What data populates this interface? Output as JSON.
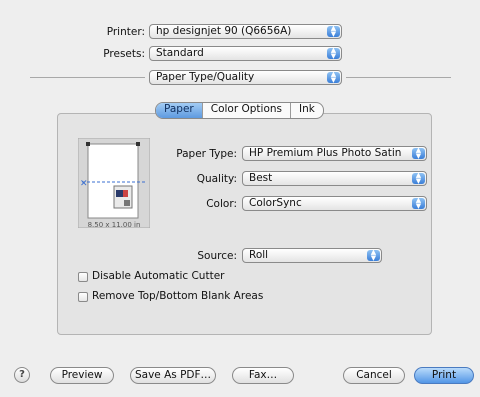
{
  "printer": {
    "label": "Printer:",
    "value": "hp designjet 90 (Q6656A)"
  },
  "presets": {
    "label": "Presets:",
    "value": "Standard"
  },
  "section": {
    "value": "Paper Type/Quality"
  },
  "tabs": [
    {
      "label": "Paper",
      "selected": true
    },
    {
      "label": "Color Options",
      "selected": false
    },
    {
      "label": "Ink",
      "selected": false
    }
  ],
  "preview": {
    "size_caption": "8.50 x 11.00 in"
  },
  "paper_type": {
    "label": "Paper Type:",
    "value": "HP Premium Plus Photo Satin"
  },
  "quality": {
    "label": "Quality:",
    "value": "Best"
  },
  "color": {
    "label": "Color:",
    "value": "ColorSync"
  },
  "source": {
    "label": "Source:",
    "value": "Roll"
  },
  "options": [
    {
      "label": "Disable Automatic Cutter",
      "checked": false
    },
    {
      "label": "Remove Top/Bottom Blank Areas",
      "checked": false
    }
  ],
  "buttons": {
    "help": "?",
    "preview": "Preview",
    "save_pdf": "Save As PDF…",
    "fax": "Fax…",
    "cancel": "Cancel",
    "print": "Print"
  },
  "icons": {
    "popup_arrow": "updown-arrows-icon",
    "help": "question-mark-icon"
  },
  "colors": {
    "accent": "#5a97e2",
    "panel": "#e4e4e4",
    "window": "#eeeeee"
  }
}
